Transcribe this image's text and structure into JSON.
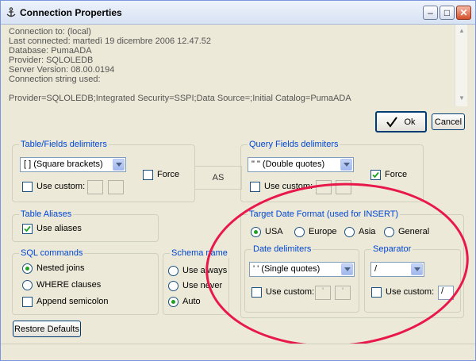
{
  "window": {
    "title": "Connection Properties",
    "minimize": "–",
    "maximize": "□",
    "close": "✕"
  },
  "info": {
    "lines": [
      "Connection to: (local)",
      "Last connected: martedì 19 dicembre 2006 12.47.52",
      "Database: PumaADA",
      "Provider: SQLOLEDB",
      "Server Version: 08.00.0194",
      "Connection string used:",
      "",
      "Provider=SQLOLEDB;Integrated Security=SSPI;Data Source=;Initial Catalog=PumaADA"
    ]
  },
  "buttons": {
    "ok": "Ok",
    "cancel": "Cancel",
    "restore": "Restore Defaults"
  },
  "table_delims": {
    "label": "Table/Fields delimiters",
    "selected": "[ ]  (Square brackets)",
    "use_custom": "Use custom:",
    "force": "Force",
    "force_checked": false,
    "use_custom_checked": false
  },
  "as_label": "AS",
  "query_delims": {
    "label": "Query Fields delimiters",
    "selected": "\" \"  (Double quotes)",
    "use_custom": "Use custom:",
    "force": "Force",
    "force_checked": true,
    "use_custom_checked": false
  },
  "aliases": {
    "label": "Table Aliases",
    "use_aliases": "Use aliases",
    "checked": true
  },
  "sql": {
    "label": "SQL commands",
    "nested": "Nested joins",
    "where": "WHERE clauses",
    "append": "Append semicolon",
    "selected": "Nested joins"
  },
  "schema": {
    "label": "Schema name",
    "always": "Use always",
    "never": "Use never",
    "auto": "Auto",
    "selected": "Auto"
  },
  "date_format": {
    "label": "Target Date Format (used for INSERT)",
    "usa": "USA",
    "europe": "Europe",
    "asia": "Asia",
    "general": "General",
    "selected": "USA"
  },
  "date_delims": {
    "label": "Date delimiters",
    "selected": "' '  (Single quotes)",
    "use_custom": "Use custom:",
    "custom1": "'",
    "custom2": "'"
  },
  "separator": {
    "label": "Separator",
    "selected": "/",
    "use_custom": "Use custom:",
    "custom": "/"
  },
  "colors": {
    "group_label": "#0046d5",
    "annotation": "#e8194a",
    "checked": "#21a121"
  },
  "icons": {
    "app": "anchor-icon",
    "ok": "checkmark-icon"
  }
}
